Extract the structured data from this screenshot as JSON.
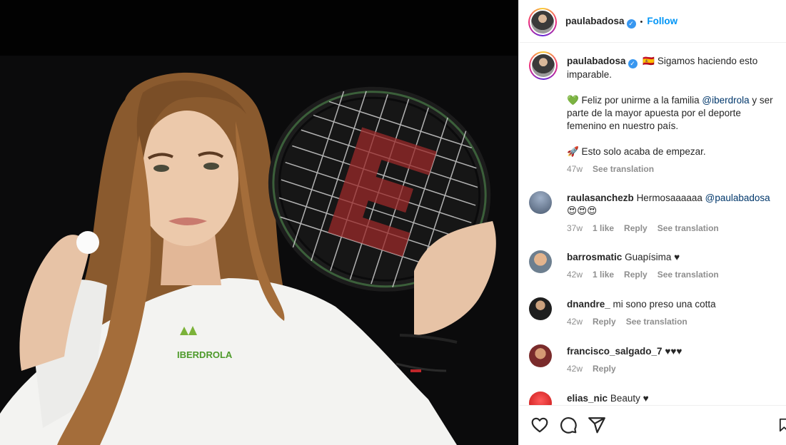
{
  "post": {
    "username": "paulabadosa",
    "verified_mark": "✓",
    "dot": "•",
    "follow_label": "Follow",
    "brand_logo_text": "IBERDROLA"
  },
  "caption": {
    "username": "paulabadosa",
    "line1": "🇪🇸 Sigamos haciendo esto imparable.",
    "line2_a": "💚 Feliz por unirme a la familia ",
    "line2_mention": "@iberdrola",
    "line2_b": " y ser parte de la mayor apuesta por el deporte femenino en nuestro país.",
    "line3": "🚀 Esto solo acaba de empezar.",
    "time": "47w",
    "translate": "See translation"
  },
  "comments": [
    {
      "username": "raulasanchezb",
      "text_a": "Hermosaaaaaa ",
      "mention": "@paulabadosa",
      "text_b": " 😍😍😍",
      "time": "37w",
      "likes": "1 like",
      "reply": "Reply",
      "translate": "See translation"
    },
    {
      "username": "barrosmatic",
      "text_a": "Guapísima ♥",
      "time": "42w",
      "likes": "1 like",
      "reply": "Reply",
      "translate": "See translation"
    },
    {
      "username": "dnandre_",
      "text_a": "mi sono preso una cotta",
      "time": "42w",
      "reply": "Reply",
      "translate": "See translation"
    },
    {
      "username": "francisco_salgado_7",
      "text_a": "♥♥♥",
      "time": "42w",
      "reply": "Reply"
    },
    {
      "username": "elias_nic",
      "text_a": "Beauty ♥"
    }
  ],
  "icons": [
    "heart-icon",
    "comment-icon",
    "share-icon",
    "bookmark-icon"
  ],
  "colors": {
    "link": "#0095f6",
    "meta": "#8e8e8e",
    "mention": "#00376b",
    "ring": "#ee2a7b"
  }
}
